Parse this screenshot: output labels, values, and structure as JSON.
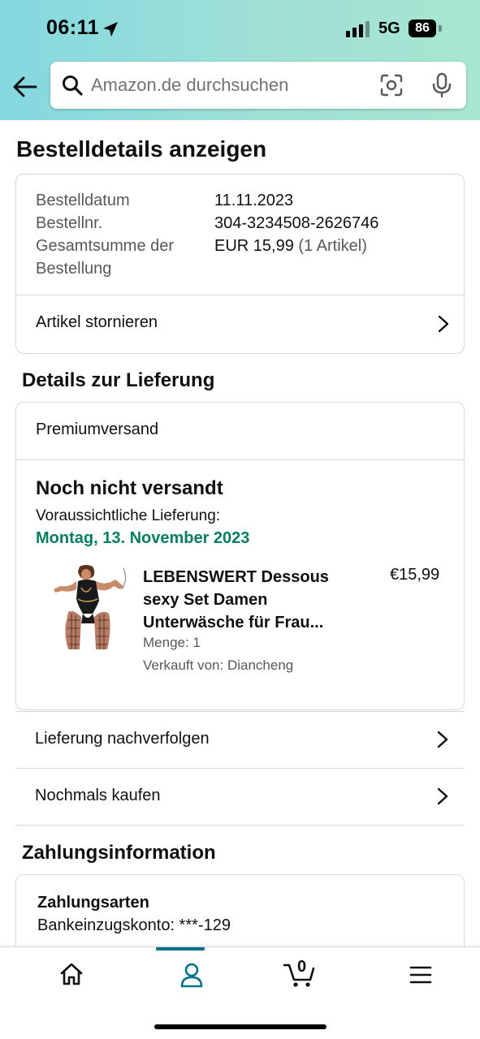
{
  "status_bar": {
    "time": "06:11",
    "network": "5G",
    "battery": "86"
  },
  "search": {
    "placeholder": "Amazon.de durchsuchen"
  },
  "page": {
    "title": "Bestelldetails anzeigen"
  },
  "order": {
    "date_label": "Bestelldatum",
    "date_value": "11.11.2023",
    "number_label": "Bestellnr.",
    "number_value": "304-3234508-2626746",
    "total_label_line1": "Gesamtsumme der",
    "total_label_line2": "Bestellung",
    "total_value": "EUR 15,99",
    "total_items": "(1 Artikel)",
    "cancel_label": "Artikel stornieren"
  },
  "delivery": {
    "section_title": "Details zur Lieferung",
    "shipping_type": "Premiumversand",
    "status": "Noch nicht versandt",
    "eta_label": "Voraussichtliche Lieferung:",
    "eta_date": "Montag, 13. November 2023",
    "product": {
      "name_line1": "LEBENSWERT Dessous",
      "name_line2": "sexy Set Damen",
      "name_line3": "Unterwäsche für Frau...",
      "price": "€15,99",
      "quantity": "Menge: 1",
      "seller": "Verkauft von: Diancheng"
    },
    "track_label": "Lieferung nachverfolgen",
    "buy_again_label": "Nochmals kaufen"
  },
  "payment": {
    "section_title": "Zahlungsinformation",
    "methods_title": "Zahlungsarten",
    "account": "Bankeinzugskonto: ***-129"
  },
  "bottom_nav": {
    "cart_count": "0",
    "items": [
      "home-icon",
      "account-icon",
      "cart-icon",
      "menu-icon"
    ],
    "active": "account-icon"
  },
  "colors": {
    "accent": "#007185",
    "delivery_green": "#067d62",
    "header_start": "#84d8e0",
    "header_end": "#a8e6cf"
  }
}
